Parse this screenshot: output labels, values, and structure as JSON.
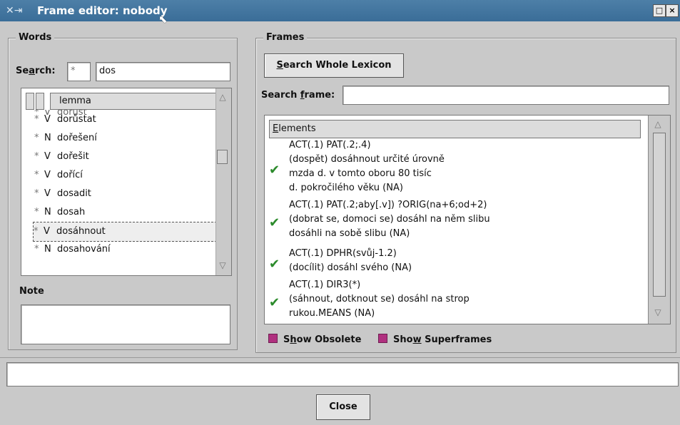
{
  "window": {
    "icon_name": "app-icon",
    "title": "Frame editor: nobody",
    "maximize_label": "□",
    "close_label": "×"
  },
  "words": {
    "legend": "Words",
    "search_label": "Search:",
    "search_prefix": "*",
    "search_value": "dos",
    "column_header": "lemma",
    "rows": [
      {
        "star": "*",
        "pos": "V",
        "lemma": "dorůst"
      },
      {
        "star": "*",
        "pos": "V",
        "lemma": "dorůstat"
      },
      {
        "star": "*",
        "pos": "N",
        "lemma": "dořešení"
      },
      {
        "star": "*",
        "pos": "V",
        "lemma": "dořešit"
      },
      {
        "star": "*",
        "pos": "V",
        "lemma": "dořící"
      },
      {
        "star": "*",
        "pos": "V",
        "lemma": "dosadit"
      },
      {
        "star": "*",
        "pos": "N",
        "lemma": "dosah"
      },
      {
        "star": "*",
        "pos": "V",
        "lemma": "dosáhnout"
      },
      {
        "star": "*",
        "pos": "N",
        "lemma": "dosahování"
      }
    ],
    "note_label": "Note"
  },
  "frames": {
    "legend": "Frames",
    "search_whole_button": "Search Whole Lexicon",
    "search_frame_label": "Search frame:",
    "search_frame_value": "",
    "elements_header": "Elements",
    "entries": [
      {
        "icon": "check-icon",
        "lines": [
          "ACT(.1)  PAT(.2;.4)",
          "(dospět) dosáhnout určité úrovně",
          "mzda d. v tomto oboru 80 tisíc",
          "d. pokročilého věku (NA)"
        ]
      },
      {
        "icon": "check-icon",
        "lines": [
          "ACT(.1)  PAT(.2;aby[.v])       ?ORIG(na+6;od+2)",
          "(dobrat se, domoci se) dosáhl na něm slibu",
          "dosáhli na sobě slibu (NA)"
        ]
      },
      {
        "icon": "check-icon",
        "lines": [
          "ACT(.1)  DPHR(svůj-1.2)",
          "(docílit) dosáhl svého (NA)"
        ]
      },
      {
        "icon": "check-icon",
        "lines": [
          "ACT(.1)  DIR3(*)",
          "(sáhnout, dotknout se) dosáhl  na strop",
          "rukou.MEANS (NA)"
        ]
      }
    ],
    "show_obsolete": "Show Obsolete",
    "show_superframes": "Show Superframes"
  },
  "footer": {
    "status_value": "",
    "close_button": "Close"
  },
  "colors": {
    "titlebar": "#3a6d98",
    "checkbox": "#b0307f",
    "check": "#2b8a2b"
  }
}
